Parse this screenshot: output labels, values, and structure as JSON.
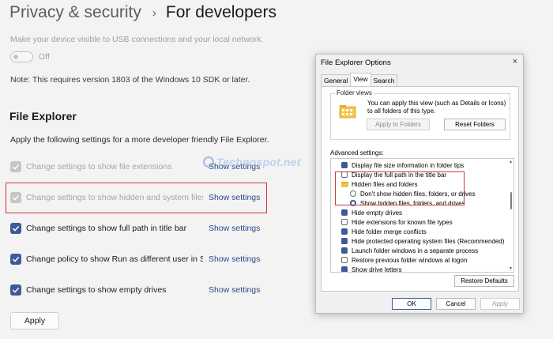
{
  "header": {
    "parent": "Privacy & security",
    "separator": "›",
    "current": "For developers"
  },
  "usb": {
    "description": "Make your device visible to USB connections and your local network.",
    "toggle_label": "Off"
  },
  "note": "Note: This requires version 1803 of the Windows 10 SDK or later.",
  "file_explorer": {
    "title": "File Explorer",
    "description": "Apply the following settings for a more developer friendly File Explorer.",
    "rows": [
      {
        "label": "Change settings to show file extensions",
        "link": "Show settings"
      },
      {
        "label": "Change settings to show hidden and system files",
        "link": "Show settings"
      },
      {
        "label": "Change settings to show full path in title bar",
        "link": "Show settings"
      },
      {
        "label": "Change policy to show Run as different user in Start",
        "link": "Show settings"
      },
      {
        "label": "Change settings to show empty drives",
        "link": "Show settings"
      }
    ],
    "apply_label": "Apply"
  },
  "watermark": "Technospot.net",
  "dialog": {
    "title": "File Explorer Options",
    "close": "×",
    "tabs": [
      "General",
      "View",
      "Search"
    ],
    "folder_views": {
      "legend": "Folder views",
      "text": "You can apply this view (such as Details or Icons) to all folders of this type.",
      "apply_to_folders": "Apply to Folders",
      "reset_folders": "Reset Folders"
    },
    "advanced_label": "Advanced settings:",
    "advanced_items": [
      "Display file size information in folder tips",
      "Display the full path in the title bar",
      "Hidden files and folders",
      "Don't show hidden files, folders, or drives",
      "Show hidden files, folders, and drives",
      "Hide empty drives",
      "Hide extensions for known file types",
      "Hide folder merge conflicts",
      "Hide protected operating system files (Recommended)",
      "Launch folder windows in a separate process",
      "Restore previous folder windows at logon",
      "Show drive letters"
    ],
    "restore_defaults": "Restore Defaults",
    "ok": "OK",
    "cancel": "Cancel",
    "apply": "Apply"
  },
  "colors": {
    "accent": "#3d5a98",
    "link": "#2d4a86",
    "highlight": "#d2373c"
  }
}
